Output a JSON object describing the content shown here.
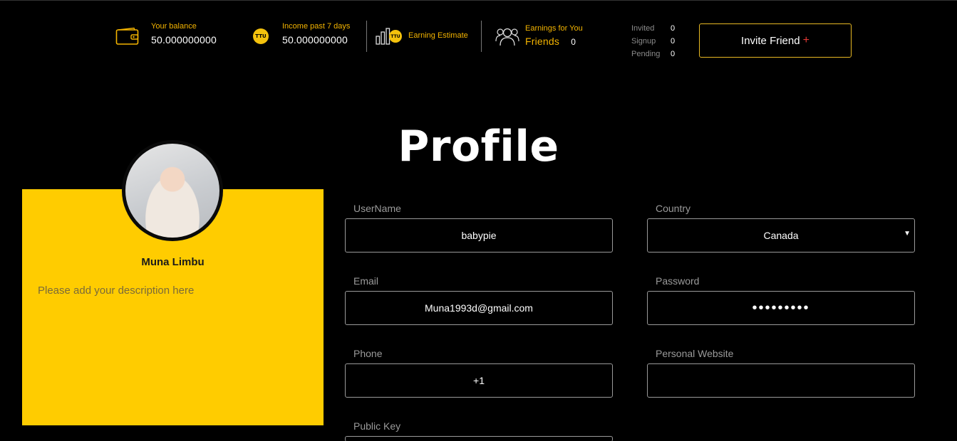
{
  "header": {
    "balance_label": "Your balance",
    "balance_value": "50.000000000",
    "income_label": "Income past 7 days",
    "income_value": "50.000000000",
    "coin_symbol": "TTU",
    "estimate_label": "Earning Estimate",
    "earnings_label": "Earnings for You",
    "friends_label": "Friends",
    "friends_value": "0",
    "invited_label": "Invited",
    "invited_value": "0",
    "signup_label": "Signup",
    "signup_value": "0",
    "pending_label": "Pending",
    "pending_value": "0",
    "invite_button_label": "Invite Friend",
    "invite_button_plus": "+"
  },
  "page": {
    "title": "Profile"
  },
  "profile_card": {
    "name": "Muna Limbu",
    "description_placeholder": "Please add your description here"
  },
  "form": {
    "username_label": "UserName",
    "username_value": "babypie",
    "country_label": "Country",
    "country_value": "Canada",
    "email_label": "Email",
    "email_value": "Muna1993d@gmail.com",
    "password_label": "Password",
    "password_value": "•••••••••",
    "phone_label": "Phone",
    "phone_value": "+1",
    "website_label": "Personal Website",
    "website_value": "",
    "public_key_label": "Public Key"
  },
  "colors": {
    "accent": "#ffcc00",
    "label_accent": "#f4b400",
    "plus": "#e53935"
  },
  "icons": [
    "wallet-icon",
    "ttu-coin-icon",
    "bar-chart-icon",
    "friends-icon",
    "chevron-down-icon"
  ]
}
